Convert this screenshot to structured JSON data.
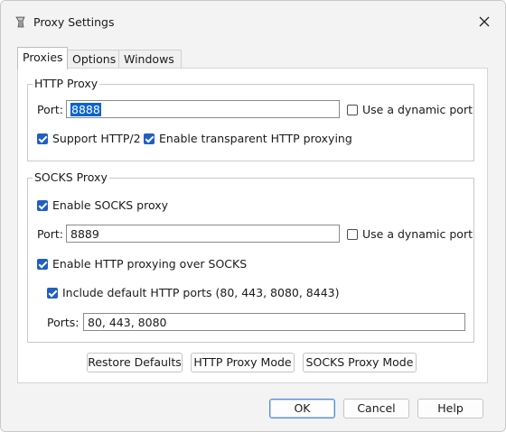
{
  "window": {
    "title": "Proxy Settings",
    "close_icon": "close-icon"
  },
  "tabs": [
    {
      "label": "Proxies",
      "active": true
    },
    {
      "label": "Options",
      "active": false
    },
    {
      "label": "Windows",
      "active": false
    }
  ],
  "http_proxy": {
    "legend": "HTTP Proxy",
    "port_label": "Port:",
    "port_value": "8888",
    "dynamic_port_label": "Use a dynamic port",
    "dynamic_port_checked": false,
    "support_http2_label": "Support HTTP/2",
    "support_http2_checked": true,
    "transparent_label": "Enable transparent HTTP proxying",
    "transparent_checked": true
  },
  "socks_proxy": {
    "legend": "SOCKS Proxy",
    "enable_label": "Enable SOCKS proxy",
    "enable_checked": true,
    "port_label": "Port:",
    "port_value": "8889",
    "dynamic_port_label": "Use a dynamic port",
    "dynamic_port_checked": false,
    "http_over_socks_label": "Enable HTTP proxying over SOCKS",
    "http_over_socks_checked": true,
    "include_default_label": "Include default HTTP ports (80, 443, 8080, 8443)",
    "include_default_checked": true,
    "ports_label": "Ports:",
    "ports_value": "80, 443, 8080"
  },
  "actions": {
    "restore_defaults": "Restore Defaults",
    "http_proxy_mode": "HTTP Proxy Mode",
    "socks_proxy_mode": "SOCKS Proxy Mode"
  },
  "footer": {
    "ok": "OK",
    "cancel": "Cancel",
    "help": "Help"
  },
  "colors": {
    "accent": "#1f5fc4",
    "selection": "#0a64d0",
    "window_bg": "#f3f3f3"
  }
}
